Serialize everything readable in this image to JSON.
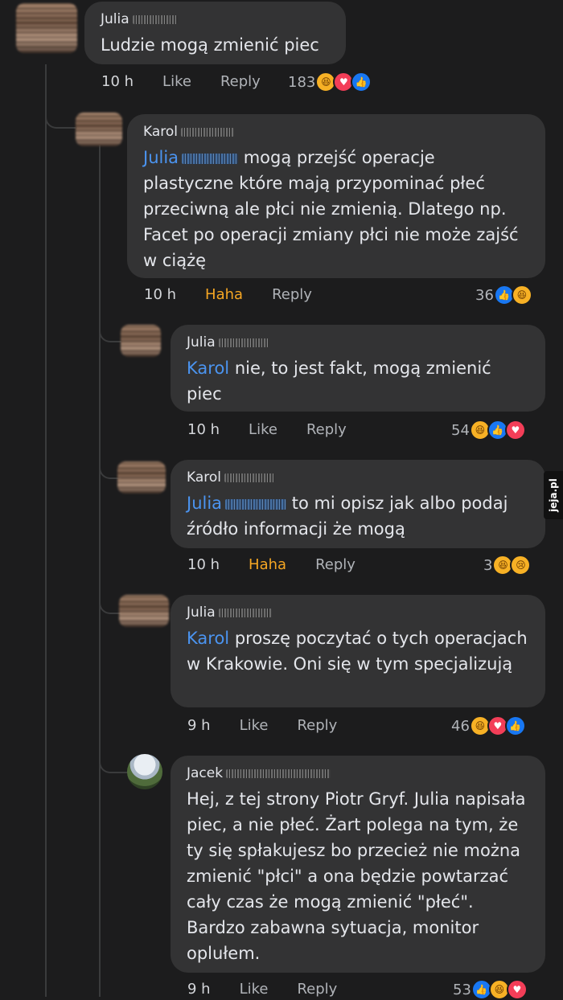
{
  "comments": [
    {
      "author": "Julia",
      "mention": "",
      "text": "Ludzie mogą zmienić piec",
      "time": "10 h",
      "action": "Like",
      "reply": "Reply",
      "count": "183",
      "reactions": [
        "haha",
        "love",
        "like"
      ]
    },
    {
      "author": "Karol",
      "mention": "Julia",
      "text": " mogą przejść operacje plastyczne które mają przypominać płeć przeciwną ale płci nie zmienią. Dlatego np. Facet po operacji zmiany płci nie może zajść w ciążę",
      "time": "10 h",
      "action": "Haha",
      "reply": "Reply",
      "count": "36",
      "reactions": [
        "like",
        "haha"
      ]
    },
    {
      "author": "Julia",
      "mention": "Karol",
      "text": " nie, to jest fakt, mogą zmienić piec",
      "time": "10 h",
      "action": "Like",
      "reply": "Reply",
      "count": "54",
      "reactions": [
        "haha",
        "like",
        "love"
      ]
    },
    {
      "author": "Karol",
      "mention": "Julia",
      "text": " to mi opisz jak albo podaj źródło informacji że mogą",
      "time": "10 h",
      "action": "Haha",
      "reply": "Reply",
      "count": "3",
      "reactions": [
        "haha",
        "sad"
      ]
    },
    {
      "author": "Julia",
      "mention": "Karol",
      "text": " proszę poczytać o tych operacjach w Krakowie. Oni się w tym specjalizują",
      "time": "9 h",
      "action": "Like",
      "reply": "Reply",
      "count": "46",
      "reactions": [
        "haha",
        "love",
        "like"
      ]
    },
    {
      "author": "Jacek",
      "mention": "",
      "text": "Hej, z tej strony Piotr Gryf. Julia napisała piec, a nie płeć. Żart polega na tym, że ty się spłakujesz bo przecież nie można zmienić \"płci\" a ona będzie powtarzać cały czas że mogą zmienić \"płeć\". Bardzo zabawna sytuacja, monitor oplułem.",
      "time": "9 h",
      "action": "Like",
      "reply": "Reply",
      "count": "53",
      "reactions": [
        "like",
        "haha",
        "love"
      ]
    }
  ],
  "watermark": "jeja.pl"
}
